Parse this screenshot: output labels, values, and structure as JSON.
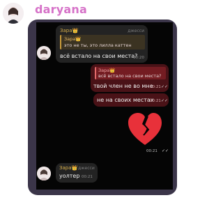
{
  "header": {
    "username": "daryana"
  },
  "messages": {
    "m1": {
      "sender": "Зара👑",
      "tag": "джесси",
      "reply_name": "Зара👑",
      "reply_text": "это не ты, это лилла каттен",
      "text": "всё встало на свои места?",
      "time": "00:20"
    },
    "m2": {
      "reply_name": "Зара👑",
      "reply_text": "всё встало на свои места?",
      "text": "твой член не во мне",
      "time": "00:21"
    },
    "m3": {
      "text": "не на своих местах",
      "time": "00:21"
    },
    "m4": {
      "emoji": "💔",
      "time": "00:21"
    },
    "m5": {
      "sender": "Зара👑",
      "tag": "джесси",
      "text": "уолтер",
      "time": "00:21"
    }
  }
}
